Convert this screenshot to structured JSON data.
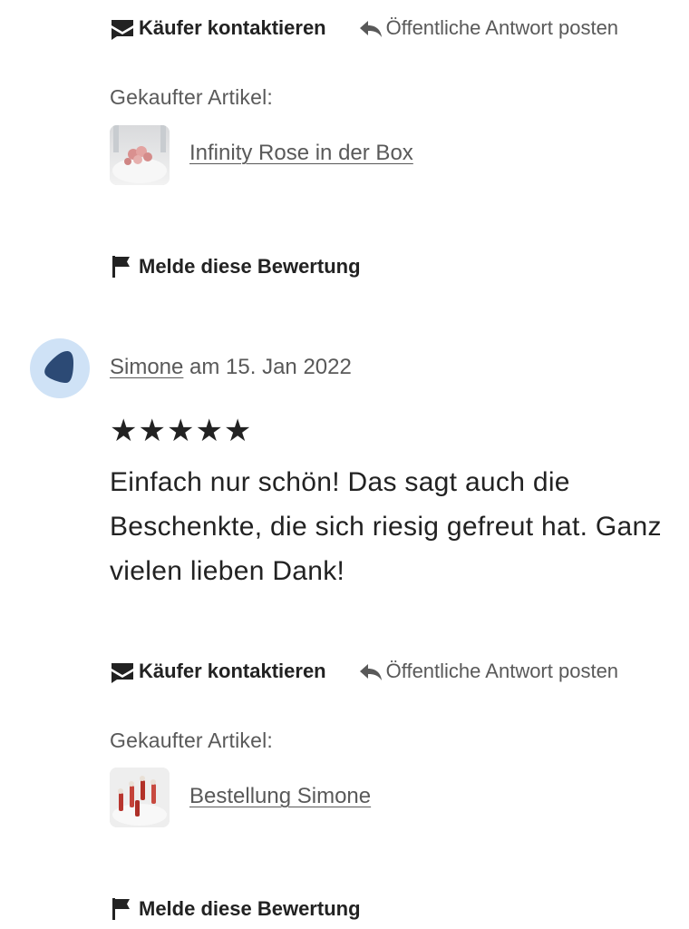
{
  "review_top": {
    "contact_label": "Käufer kontaktieren",
    "reply_label": "Öffentliche Antwort posten",
    "purchased_label": "Gekaufter Artikel:",
    "item_title": "Infinity Rose in der Box",
    "report_label": "Melde diese Bewertung"
  },
  "review_bottom": {
    "reviewer_name": "Simone",
    "date_text": "am 15. Jan 2022",
    "stars": "★★★★★",
    "rating": 5,
    "text": "Einfach nur schön! Das sagt auch die Beschenkte, die sich riesig gefreut hat. Ganz vielen lieben Dank!",
    "contact_label": "Käufer kontaktieren",
    "reply_label": "Öffentliche Antwort posten",
    "purchased_label": "Gekaufter Artikel:",
    "item_title": "Bestellung Simone",
    "report_label": "Melde diese Bewertung"
  },
  "colors": {
    "text_primary": "#222222",
    "text_secondary": "#595959",
    "avatar_bg": "#cfe2f6",
    "avatar_shape": "#2c4a75"
  },
  "icons": [
    "mail-icon",
    "reply-arrow-icon",
    "flag-icon",
    "avatar-shape-icon"
  ]
}
